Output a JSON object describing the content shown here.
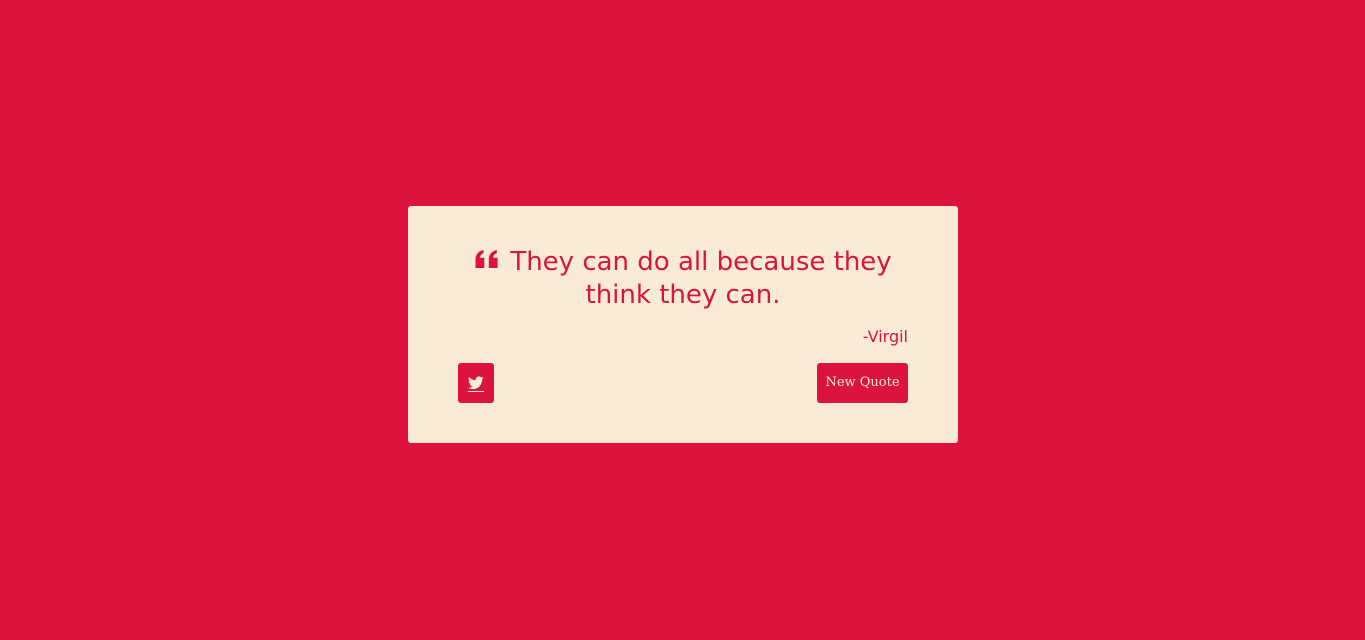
{
  "colors": {
    "background": "#dc143c",
    "card": "#faebd7",
    "accent": "#dc143c"
  },
  "quote": {
    "icon": "quote-left-icon",
    "text": "They can do all because they think they can.",
    "author": "-Virgil"
  },
  "actions": {
    "tweet_icon": "twitter-icon",
    "new_quote_label": "New Quote"
  }
}
